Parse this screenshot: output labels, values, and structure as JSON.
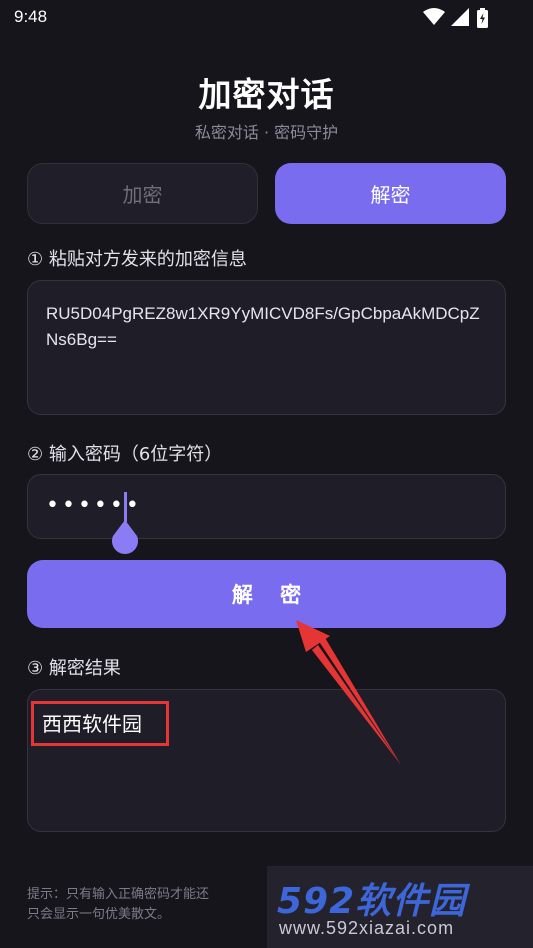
{
  "status_bar": {
    "time": "9:48",
    "icons": [
      "wifi-icon",
      "signal-icon",
      "battery-charging-icon"
    ]
  },
  "header": {
    "title": "加密对话",
    "subtitle": "私密对话 · 密码守护"
  },
  "tabs": [
    {
      "label": "加密",
      "active": false
    },
    {
      "label": "解密",
      "active": true
    }
  ],
  "step1": {
    "label": "① 粘贴对方发来的加密信息",
    "value": "RU5D04PgREZ8w1XR9YyMICVD8Fs/GpCbpaAkMDCpZNs6Bg=="
  },
  "step2": {
    "label": "② 输入密码（6位字符）",
    "value_masked": "••••••"
  },
  "action": {
    "button_label": "解 密"
  },
  "step3": {
    "label": "③ 解密结果",
    "value": "西西软件园"
  },
  "hint": {
    "line1": "提示：只有输入正确密码才能还",
    "line2": "只会显示一句优美散文。"
  },
  "watermark": {
    "main": "592软件园",
    "url": "www.592xiazai.com"
  },
  "colors": {
    "background": "#16151c",
    "accent": "#7a6cef",
    "annotation_red": "#e53535",
    "watermark_blue": "#3d67d8"
  }
}
